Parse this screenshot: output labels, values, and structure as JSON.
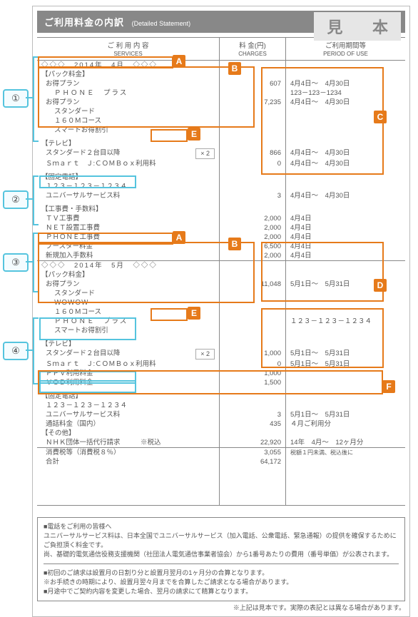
{
  "header": {
    "title": "ご利用料金の内訳",
    "subtitle": "(Detailed Statement)"
  },
  "sample_badge": "見 本",
  "columns": {
    "services": "ご 利 用 内 容",
    "services_sub": "SERVICES",
    "charges": "料 金(円)",
    "charges_sub": "CHARGES",
    "period": "ご利用期間等",
    "period_sub": "PERIOD OF USE"
  },
  "month1": {
    "label": "◇◇◇　2014年　4月　◇◇◇",
    "pack_hdr": "【パック料金】",
    "rows": [
      {
        "s": "お得プラン",
        "a": "607",
        "p": "4月4日～　4月30日",
        "i": 1
      },
      {
        "s": "ＰＨＯＮＥ　プラス",
        "a": "",
        "p": "123－123－1234",
        "i": 2
      },
      {
        "s": "お得プラン",
        "a": "7,235",
        "p": "4月4日～　4月30日",
        "i": 1
      },
      {
        "s": "スタンダード",
        "a": "",
        "p": "",
        "i": 2
      },
      {
        "s": "１６０Ｍコース",
        "a": "",
        "p": "",
        "i": 2
      },
      {
        "s": "スマートお得割引",
        "a": "",
        "p": "",
        "i": 2
      }
    ],
    "tv_hdr": "【テレビ】",
    "tv": [
      {
        "s": "スタンダード２台目以降",
        "mult": "× 2",
        "a": "866",
        "p": "4月4日～　4月30日"
      },
      {
        "s": "Ｓｍａｒｔ　Ｊ:ＣＯＭＢｏｘ利用料",
        "a": "0",
        "p": "4月4日～　4月30日"
      }
    ],
    "tel_hdr": "【固定電話】",
    "tel": [
      {
        "s": "１２３－１２３－１２３４",
        "a": "",
        "p": ""
      },
      {
        "s": "ユニバーサルサービス料",
        "a": "3",
        "p": "4月4日～　4月30日"
      }
    ],
    "fee_hdr": "【工事費・手数料】",
    "fees": [
      {
        "s": "ＴＶ工事費",
        "a": "2,000",
        "p": "4月4日"
      },
      {
        "s": "ＮＥＴ設置工事費",
        "a": "2,000",
        "p": "4月4日"
      },
      {
        "s": "ＰＨＯＮＥ工事費",
        "a": "2,000",
        "p": "4月4日"
      },
      {
        "s": "ブースター料金",
        "a": "6,500",
        "p": "4月4日"
      },
      {
        "s": "新規加入手数料",
        "a": "2,000",
        "p": "4月4日"
      }
    ]
  },
  "month2": {
    "label": "◇◇◇　2014年　5月　◇◇◇",
    "pack_hdr": "【パック料金】",
    "rows": [
      {
        "s": "お得プラン",
        "a": "11,048",
        "p": "5月1日～　5月31日",
        "i": 1
      },
      {
        "s": "スタンダード",
        "a": "",
        "p": "",
        "i": 2
      },
      {
        "s": "ＷＯＷＯＷ",
        "a": "",
        "p": "",
        "i": 2
      },
      {
        "s": "１６０Ｍコース",
        "a": "",
        "p": "",
        "i": 2
      },
      {
        "s": "ＰＨＯＮＥ　プラス",
        "a": "",
        "p": "１２３－１２３－１２３４",
        "i": 2
      },
      {
        "s": "スマートお得割引",
        "a": "",
        "p": "",
        "i": 2
      }
    ],
    "tv_hdr": "【テレビ】",
    "tv": [
      {
        "s": "スタンダード２台目以降",
        "mult": "× 2",
        "a": "1,000",
        "p": "5月1日～　5月31日"
      },
      {
        "s": "Ｓｍａｒｔ　Ｊ:ＣＯＭＢｏｘ利用料",
        "a": "0",
        "p": "5月1日～　5月31日"
      },
      {
        "s": "ＰＰＶ利用料金",
        "a": "1,000",
        "p": ""
      },
      {
        "s": "ＶＯＤ利用料金",
        "a": "1,500",
        "p": ""
      }
    ],
    "tel_hdr": "【固定電話】",
    "tel": [
      {
        "s": "１２３－１２３－１２３４",
        "a": "",
        "p": ""
      },
      {
        "s": "ユニバーサルサービス料",
        "a": "3",
        "p": "5月1日～　5月31日"
      },
      {
        "s": "通話料金（国内）",
        "a": "435",
        "p": "４月ご利用分"
      }
    ],
    "other_hdr": "【その他】",
    "other": [
      {
        "s": "ＮＨＫ団体一括代行請求　　　※税込",
        "a": "22,920",
        "p": "14年　4月～　12ヶ月分"
      }
    ]
  },
  "totals": {
    "tax_label": "消費税等（消費税８％）",
    "tax": "3,055",
    "tax_note": "税額１円未満、税込後に",
    "total_label": "合計",
    "total": "64,172"
  },
  "notes": {
    "n1_title": "■電話をご利用の皆様へ",
    "n1_body1": "ユニバーサルサービス料は、日本全国でユニバーサルサービス（加入電話、公衆電話、緊急通報）の提供を確保するためにご負担頂く料金です。",
    "n1_body2": "尚、基礎的電気通信役務支援機関（社団法人電気通信事業者協会）から1番号あたりの費用（番号単価）が公表されます。",
    "n2_a": "■初回のご請求は設置月の日割り分と設置月翌月の1ヶ月分の合算となります。",
    "n2_b": "※お手続きの時期により、設置月翌々月までを合算したご請求となる場合があります。",
    "n2_c": "■月途中でご契約内容を変更した場合、翌月の請求にて精算となります。"
  },
  "footnote": "※上記は見本です。実際の表記とは異なる場合があります。",
  "callouts": {
    "num1": "①",
    "num2": "②",
    "num3": "③",
    "num4": "④",
    "A": "A",
    "B": "B",
    "C": "C",
    "D": "D",
    "E": "E",
    "F": "F"
  }
}
